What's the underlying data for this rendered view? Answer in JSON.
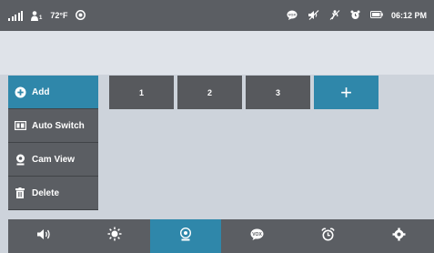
{
  "status_bar": {
    "temperature": "72°F",
    "person_subscript": "1",
    "time": "06:12 PM"
  },
  "slots": [
    "1",
    "2",
    "3",
    "+"
  ],
  "side_menu": {
    "items": [
      {
        "label": "Add",
        "icon": "plus-circle-icon",
        "active": true
      },
      {
        "label": "Auto Switch",
        "icon": "auto-switch-icon",
        "active": false
      },
      {
        "label": "Cam View",
        "icon": "camera-icon",
        "active": false
      },
      {
        "label": "Delete",
        "icon": "trash-icon",
        "active": false
      }
    ]
  },
  "bottom_bar": {
    "items": [
      {
        "icon": "speaker-icon",
        "active": false
      },
      {
        "icon": "brightness-icon",
        "active": false
      },
      {
        "icon": "camera-icon",
        "active": true
      },
      {
        "icon": "vox-icon",
        "active": false
      },
      {
        "icon": "alarm-clock-icon",
        "active": false
      },
      {
        "icon": "settings-icon",
        "active": false
      }
    ]
  },
  "colors": {
    "bar": "#5b5e63",
    "accent": "#2f87aa",
    "background": "#cdd3db"
  }
}
